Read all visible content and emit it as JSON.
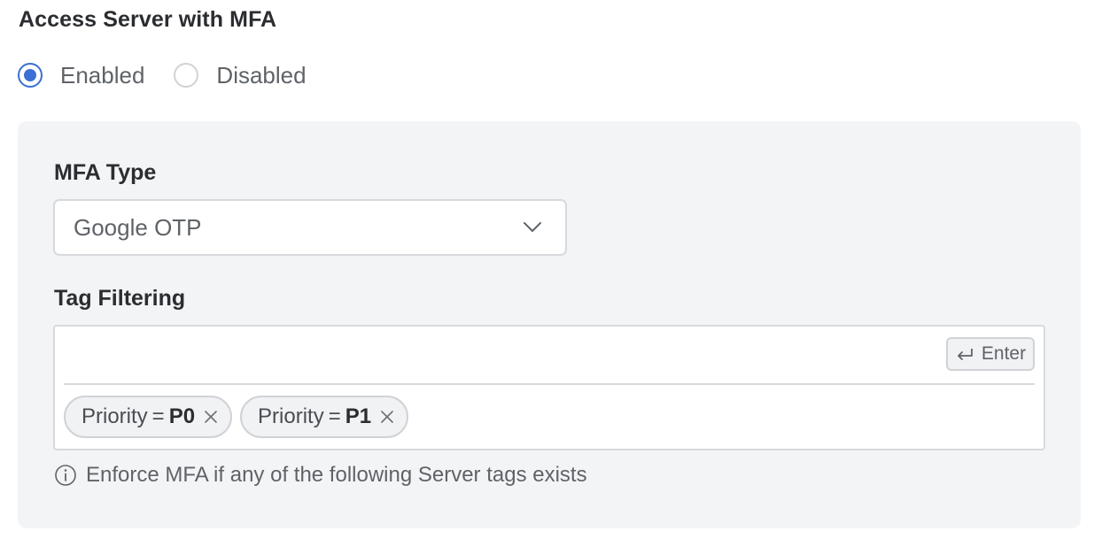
{
  "section": {
    "title": "Access Server with MFA"
  },
  "mfa_toggle": {
    "options": [
      {
        "label": "Enabled",
        "selected": true
      },
      {
        "label": "Disabled",
        "selected": false
      }
    ]
  },
  "mfa_type": {
    "label": "MFA Type",
    "value": "Google OTP",
    "icon": "chevron-down-icon"
  },
  "tag_filtering": {
    "label": "Tag Filtering",
    "input_value": "",
    "enter_label": "Enter",
    "enter_icon": "return-icon",
    "tags": [
      {
        "key": "Priority",
        "operator": "=",
        "value": "P0"
      },
      {
        "key": "Priority",
        "operator": "=",
        "value": "P1"
      }
    ],
    "hint": "Enforce MFA if any of the following Server tags exists",
    "hint_icon": "info-icon"
  },
  "colors": {
    "accent": "#3b6fd4",
    "panel_bg": "#f3f4f6",
    "border": "#d7d9dd",
    "text_primary": "#2b2d31",
    "text_secondary": "#5f6368"
  }
}
